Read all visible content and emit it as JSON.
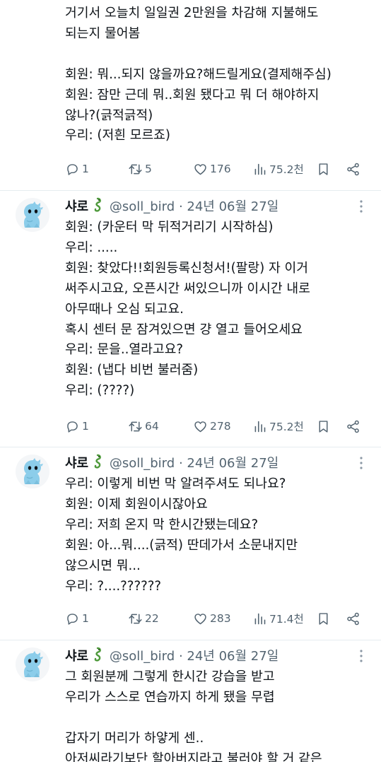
{
  "tweets": [
    {
      "text": "거기서 오늘치 일일권 2만원을 차감해 지불해도\n되는지 물어봄\n\n회원: 뭐...되지 않을까요?해드릴게요(결제해주심)\n회원: 잠만 근데 뭐..회원 됐다고 뭐 더 해야하지\n않나?(긁적긁적)\n우리: (저흰 모르죠)",
      "replies": "1",
      "retweets": "5",
      "likes": "176",
      "views": "75.2천"
    },
    {
      "author": "샤로",
      "handle": "@soll_bird",
      "date": "24년 06월 27일",
      "text": "회원: (카운터 막 뒤적거리기 시작하심)\n우리: .....\n회원: 찾았다!!회원등록신청서!(팔랑) 자 이거\n써주시고요, 오픈시간 써있으니까 이시간 내로\n아무때나 오심 되고요.\n혹시 센터 문 잠겨있으면 걍 열고 들어오세요\n우리: 문을..열라고요?\n회원: (냅다 비번 불러줌)\n우리: (????)",
      "replies": "1",
      "retweets": "64",
      "likes": "278",
      "views": "75.2천"
    },
    {
      "author": "샤로",
      "handle": "@soll_bird",
      "date": "24년 06월 27일",
      "text": "우리: 이렇게 비번 막 알려주셔도 되나요?\n회원: 이제 회원이시잖아요\n우리: 저희 온지 막 한시간됐는데요?\n회원: 아...뭐....(긁적) 딴데가서 소문내지만\n않으시면 뭐...\n우리: ?....??????",
      "replies": "1",
      "retweets": "22",
      "likes": "283",
      "views": "71.4천"
    },
    {
      "author": "샤로",
      "handle": "@soll_bird",
      "date": "24년 06월 27일",
      "text": "그 회원분께 그렇게 한시간 강습을 받고\n우리가 스스로 연습까지 하게 됐을 무렵\n\n갑자기 머리가 하얗게 센..\n아저씨라기보단 할아버지라고 불러야 할 거 같은"
    }
  ],
  "separator": "·",
  "colors": {
    "text": "#0f1419",
    "secondary": "#536471",
    "divider": "#e6ecf0",
    "avatar": "#8ccdea"
  },
  "icons": [
    "reply-icon",
    "retweet-icon",
    "like-icon",
    "views-icon",
    "bookmark-icon",
    "share-icon",
    "more-icon",
    "dragon-emoji-icon"
  ]
}
